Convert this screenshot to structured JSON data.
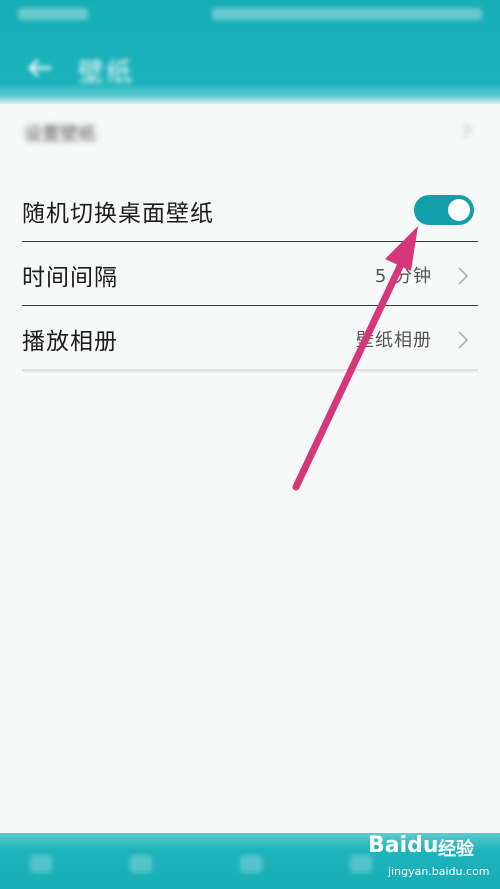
{
  "header": {
    "title": "壁纸"
  },
  "rows": [
    {
      "label": "设置壁纸"
    },
    {
      "label": "随机切换桌面壁纸",
      "toggle_on": true
    },
    {
      "label": "时间间隔",
      "value": "5 分钟"
    },
    {
      "label": "播放相册",
      "value": "壁纸相册"
    }
  ],
  "colors": {
    "accent": "#11a0ab",
    "header": "#17adb5",
    "arrow": "#d6367a"
  },
  "watermark": {
    "logo": "Bai",
    "paw": "du",
    "jingyan": "经验",
    "domain": "jingyan.baidu.com"
  }
}
